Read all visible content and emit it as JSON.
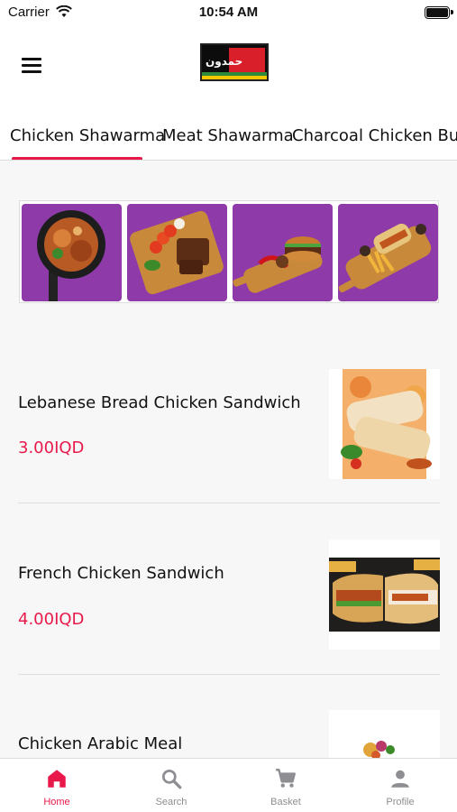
{
  "status_bar": {
    "carrier": "Carrier",
    "time": "10:54 AM"
  },
  "header": {
    "menu_icon": "hamburger-menu-icon",
    "logo_text": "حمدون"
  },
  "tabs": [
    {
      "label": "Chicken Shawarma",
      "active": true
    },
    {
      "label": "Meat Shawarma",
      "active": false
    },
    {
      "label": "Charcoal Chicken Burg",
      "active": false
    }
  ],
  "banner": {
    "tiles": [
      "chicken-fries-plate",
      "meat-platter-board",
      "burger-board",
      "sandwich-fries-board"
    ]
  },
  "products": [
    {
      "name": "Lebanese Bread Chicken Sandwich",
      "price": "3.00IQD"
    },
    {
      "name": "French Chicken Sandwich",
      "price": "4.00IQD"
    },
    {
      "name": "Chicken Arabic Meal",
      "price": ""
    }
  ],
  "bottom_nav": [
    {
      "label": "Home",
      "icon": "home-icon",
      "active": true
    },
    {
      "label": "Search",
      "icon": "search-icon",
      "active": false
    },
    {
      "label": "Basket",
      "icon": "cart-icon",
      "active": false
    },
    {
      "label": "Profile",
      "icon": "person-icon",
      "active": false
    }
  ],
  "colors": {
    "accent": "#e8194a",
    "inactive": "#8e8e93",
    "banner_bg": "#8e3aa8"
  }
}
